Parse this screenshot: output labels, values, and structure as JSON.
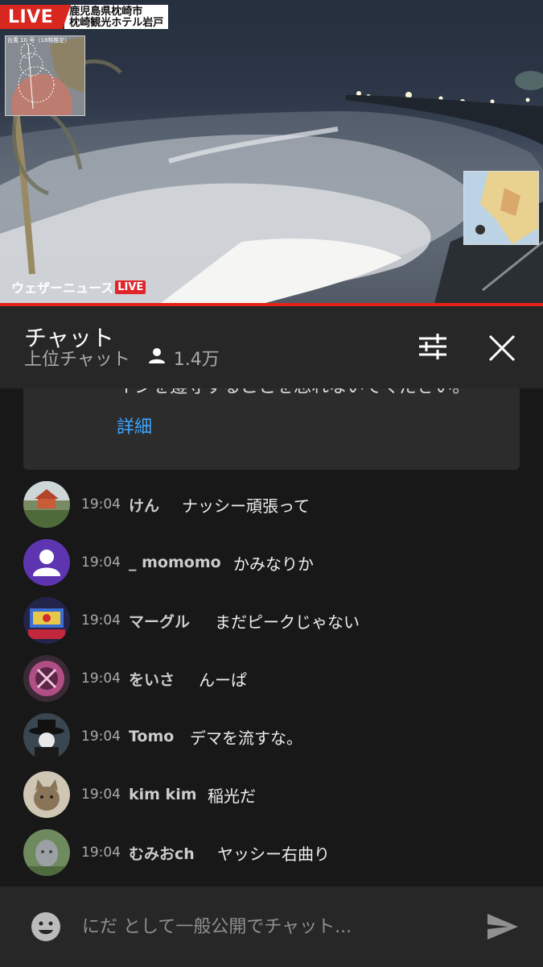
{
  "video": {
    "live_label": "LIVE",
    "location_line1": "鹿児島県枕崎市",
    "location_line2": "枕崎観光ホテル岩戸",
    "typhoon_map_title": "台風 10 号（18時推定）",
    "brand": "ウェザーニュース",
    "brand_live": "LIVE",
    "progress_percent": 100
  },
  "chat": {
    "title": "チャット",
    "mode": "上位チャット",
    "viewer_count": "1.4万",
    "notice_text": "インを遵守することを忘れないでください。",
    "notice_more": "詳細"
  },
  "messages": [
    {
      "time": "19:04",
      "author": "けん",
      "text": "ナッシー頑張って",
      "avatar": "temple-photo-avatar"
    },
    {
      "time": "19:04",
      "author": "_ momomo",
      "text": "かみなりか",
      "avatar": "default-user-avatar"
    },
    {
      "time": "19:04",
      "author": "マーグル",
      "text": "まだピークじゃない",
      "avatar": "pachinko-machine-avatar"
    },
    {
      "time": "19:04",
      "author": "をいさ",
      "text": "んーぱ",
      "avatar": "pink-logo-avatar"
    },
    {
      "time": "19:04",
      "author": "Tomo",
      "text": "デマを流すな。",
      "avatar": "hat-character-avatar"
    },
    {
      "time": "19:04",
      "author": "kim kim",
      "text": "稲光だ",
      "avatar": "cat-photo-avatar"
    },
    {
      "time": "19:04",
      "author": "むみおch",
      "text": "ヤッシー右曲り",
      "avatar": "statue-photo-avatar"
    }
  ],
  "input": {
    "placeholder": "にだ として一般公開でチャット..."
  },
  "colors": {
    "accent_red": "#e62117",
    "link_blue": "#3ea6ff",
    "header_bg": "#272727",
    "body_bg": "#181818"
  }
}
